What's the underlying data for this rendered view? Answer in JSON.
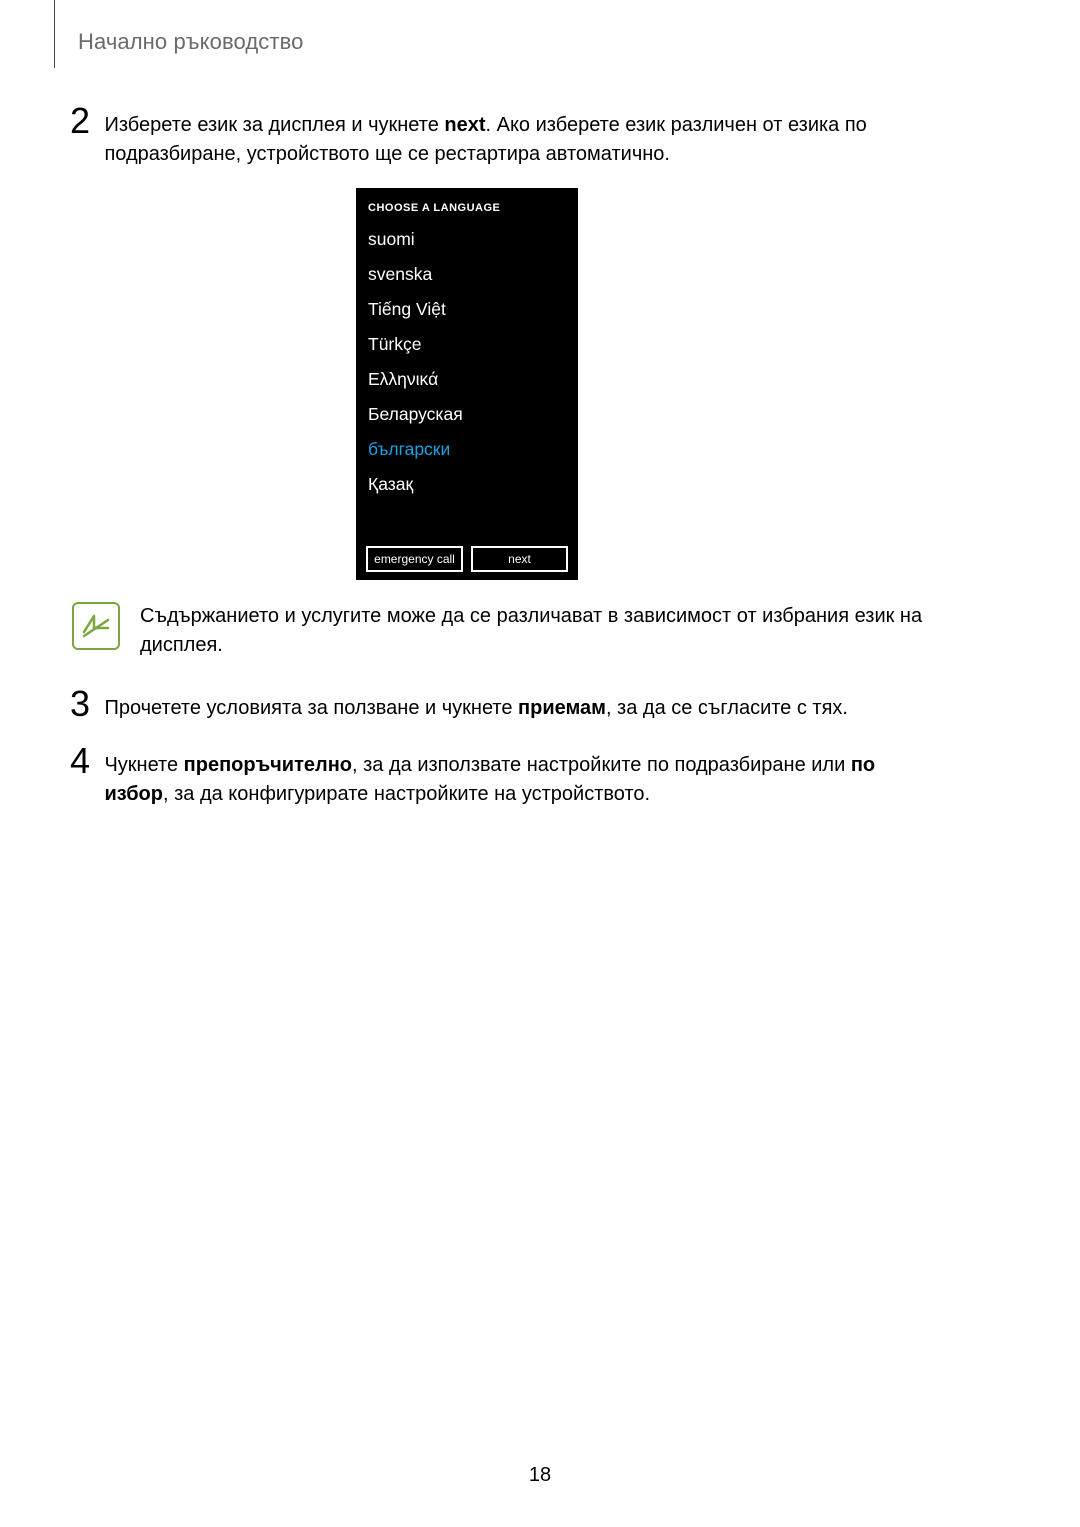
{
  "header": {
    "title": "Начално ръководство"
  },
  "steps": {
    "s2": {
      "num": "2",
      "part1": "Изберете език за дисплея и чукнете ",
      "bold1": "next",
      "part2": ". Ако изберете език различен от езика по подразбиране, устройството ще се рестартира автоматично."
    },
    "s3": {
      "num": "3",
      "part1": "Прочетете условията за ползване и чукнете ",
      "bold1": "приемам",
      "part2": ", за да се съгласите с тях."
    },
    "s4": {
      "num": "4",
      "part1": "Чукнете ",
      "bold1": "препоръчително",
      "part2": ", за да използвате настройките по подразбиране или ",
      "bold2": "по избор",
      "part3": ", за да конфигурирате настройките на устройството."
    }
  },
  "phone": {
    "title": "CHOOSE A LANGUAGE",
    "langs": {
      "l0": "suomi",
      "l1": "svenska",
      "l2": "Tiếng Việt",
      "l3": "Türkçe",
      "l4": "Ελληνικά",
      "l5": "Беларуская",
      "l6": "български",
      "l7": "Қазақ"
    },
    "buttons": {
      "emergency": "emergency call",
      "next": "next"
    }
  },
  "note": {
    "text": "Съдържанието и услугите може да се различават в зависимост от избрания език на дисплея."
  },
  "page_number": "18"
}
